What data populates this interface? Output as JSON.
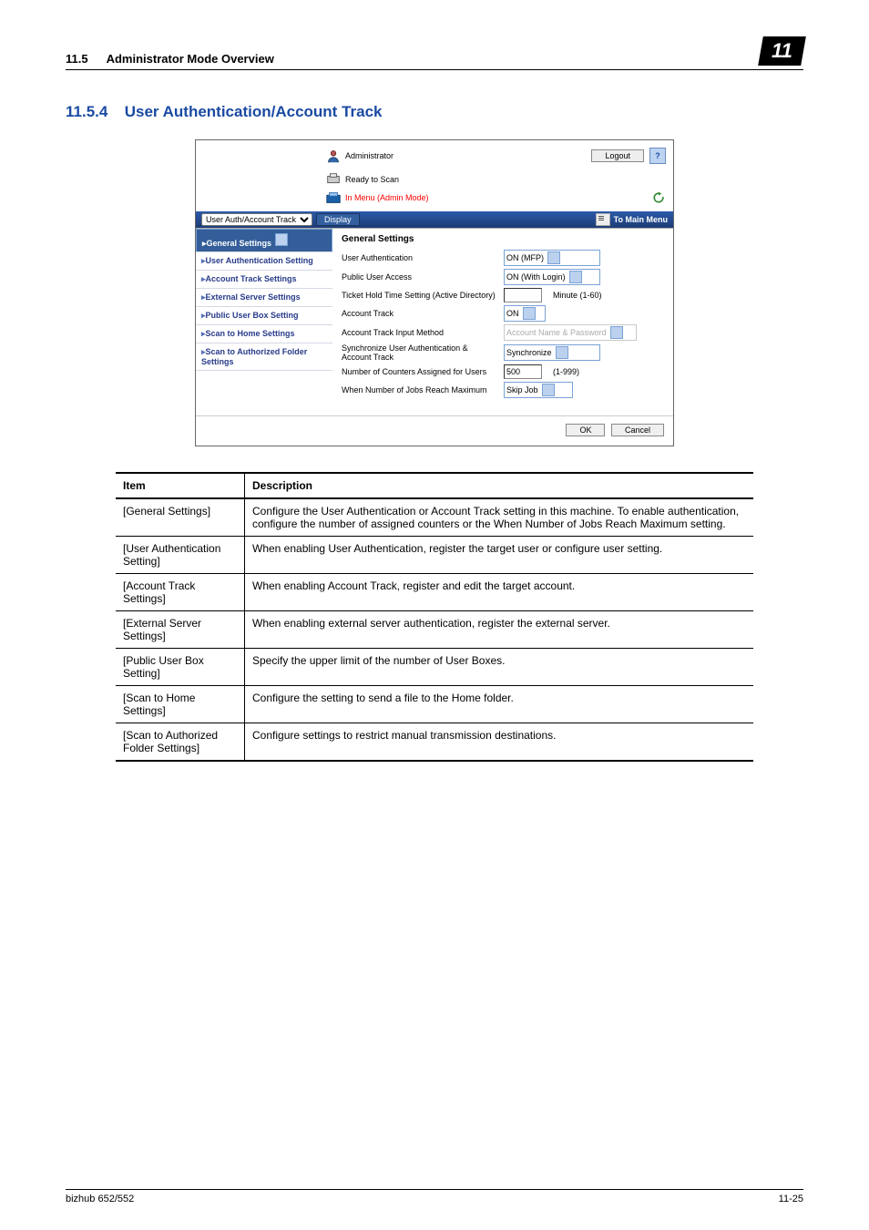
{
  "header": {
    "sec": "11.5",
    "title": "Administrator Mode Overview",
    "badge": "11"
  },
  "subhead": {
    "num": "11.5.4",
    "title": "User Authentication/Account Track"
  },
  "ui": {
    "role": "Administrator",
    "logout": "Logout",
    "help": "?",
    "status1": "Ready to Scan",
    "status2": "In Menu (Admin Mode)",
    "navselect": "User Auth/Account Track",
    "display": "Display",
    "mainmenu": "To Main Menu",
    "side": [
      {
        "label": "General Settings",
        "sel": true
      },
      {
        "label": "User Authentication Setting"
      },
      {
        "label": "Account Track Settings"
      },
      {
        "label": "External Server Settings"
      },
      {
        "label": "Public User Box Setting"
      },
      {
        "label": "Scan to Home Settings"
      },
      {
        "label": "Scan to Authorized Folder Settings"
      }
    ],
    "panel_title": "General Settings",
    "fields": {
      "user_auth": {
        "label": "User Authentication",
        "value": "ON (MFP)"
      },
      "public": {
        "label": "Public User Access",
        "value": "ON (With Login)"
      },
      "ticket": {
        "label": "Ticket Hold Time Setting (Active Directory)",
        "value": "",
        "hint": "Minute (1-60)"
      },
      "acct": {
        "label": "Account Track",
        "value": "ON"
      },
      "method": {
        "label": "Account Track Input Method",
        "value": "Account Name & Password"
      },
      "sync": {
        "label": "Synchronize User Authentication & Account Track",
        "value": "Synchronize"
      },
      "counters": {
        "label": "Number of Counters Assigned for Users",
        "value": "500",
        "hint": "(1-999)"
      },
      "maxjob": {
        "label": "When Number of Jobs Reach Maximum",
        "value": "Skip Job"
      }
    },
    "ok": "OK",
    "cancel": "Cancel"
  },
  "table": {
    "head": [
      "Item",
      "Description"
    ],
    "rows": [
      [
        "[General Settings]",
        "Configure the User Authentication or Account Track setting in this machine. To enable authentication, configure the number of assigned counters or the When Number of Jobs Reach Maximum setting."
      ],
      [
        "[User Authentication Setting]",
        "When enabling User Authentication, register the target user or configure user setting."
      ],
      [
        "[Account Track Settings]",
        "When enabling Account Track, register and edit the target account."
      ],
      [
        "[External Server Settings]",
        "When enabling external server authentication, register the external server."
      ],
      [
        "[Public User Box Setting]",
        "Specify the upper limit of the number of User Boxes."
      ],
      [
        "[Scan to Home Settings]",
        "Configure the setting to send a file to the Home folder."
      ],
      [
        "[Scan to Authorized Folder Settings]",
        "Configure settings to restrict manual transmission destinations."
      ]
    ]
  },
  "footer": {
    "left": "bizhub 652/552",
    "right": "11-25"
  }
}
